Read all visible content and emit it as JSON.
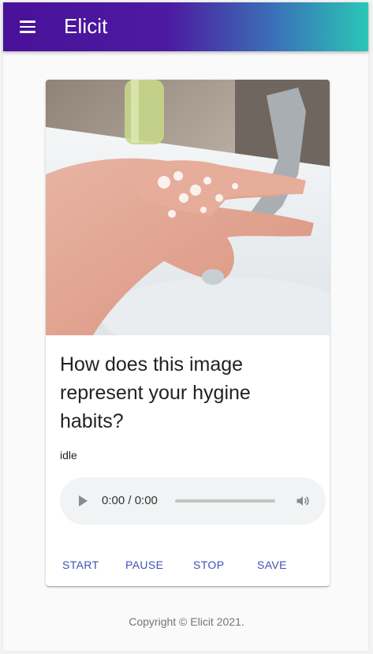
{
  "appbar": {
    "title": "Elicit"
  },
  "card": {
    "question": "How does this image represent your hygine habits?",
    "status": "idle",
    "audio": {
      "time": "0:00 / 0:00"
    },
    "actions": [
      "START",
      "PAUSE",
      "STOP",
      "SAVE"
    ]
  },
  "footer": {
    "copyright": "Copyright © Elicit 2021."
  },
  "colors": {
    "accent": "#3f51b5",
    "gradient_start": "#4a1199",
    "gradient_end": "#2ac7b6"
  }
}
